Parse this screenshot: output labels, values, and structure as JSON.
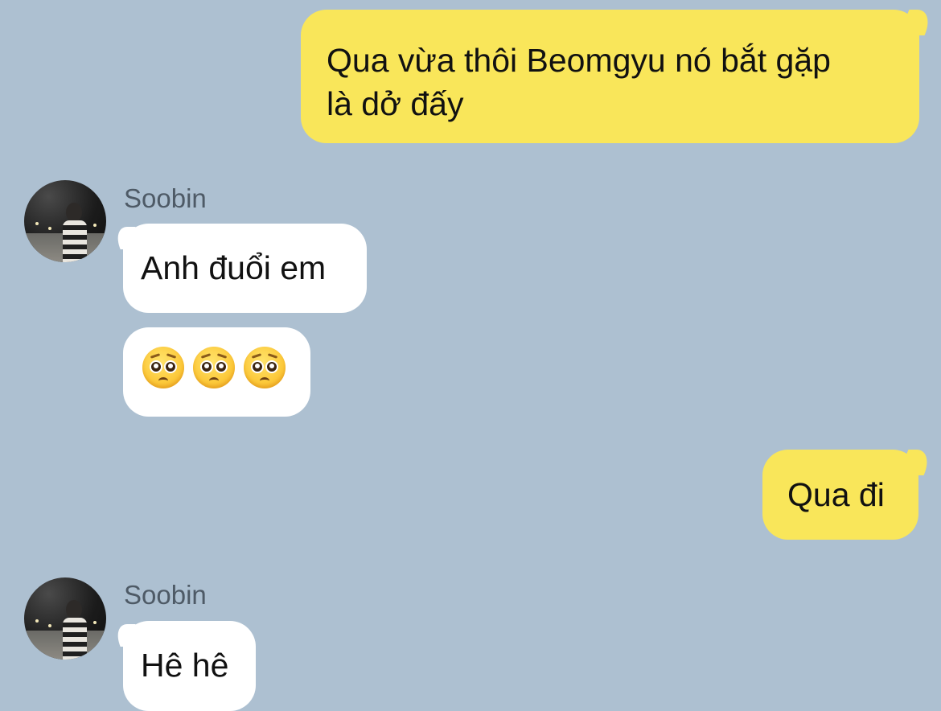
{
  "chat": {
    "background": "#adc0d1",
    "outgoing_color": "#f9e65a",
    "incoming_color": "#ffffff",
    "messages": [
      {
        "side": "out",
        "text": "Qua vừa thôi Beomgyu nó bắt gặp\nlà dở đấy"
      },
      {
        "side": "in",
        "sender": "Soobin",
        "text": "Anh đuổi em"
      },
      {
        "side": "in",
        "emoji": [
          "pleading-face",
          "pleading-face",
          "pleading-face"
        ]
      },
      {
        "side": "out",
        "text": "Qua đi"
      },
      {
        "side": "in",
        "sender": "Soobin",
        "text": "Hê hê"
      }
    ]
  }
}
